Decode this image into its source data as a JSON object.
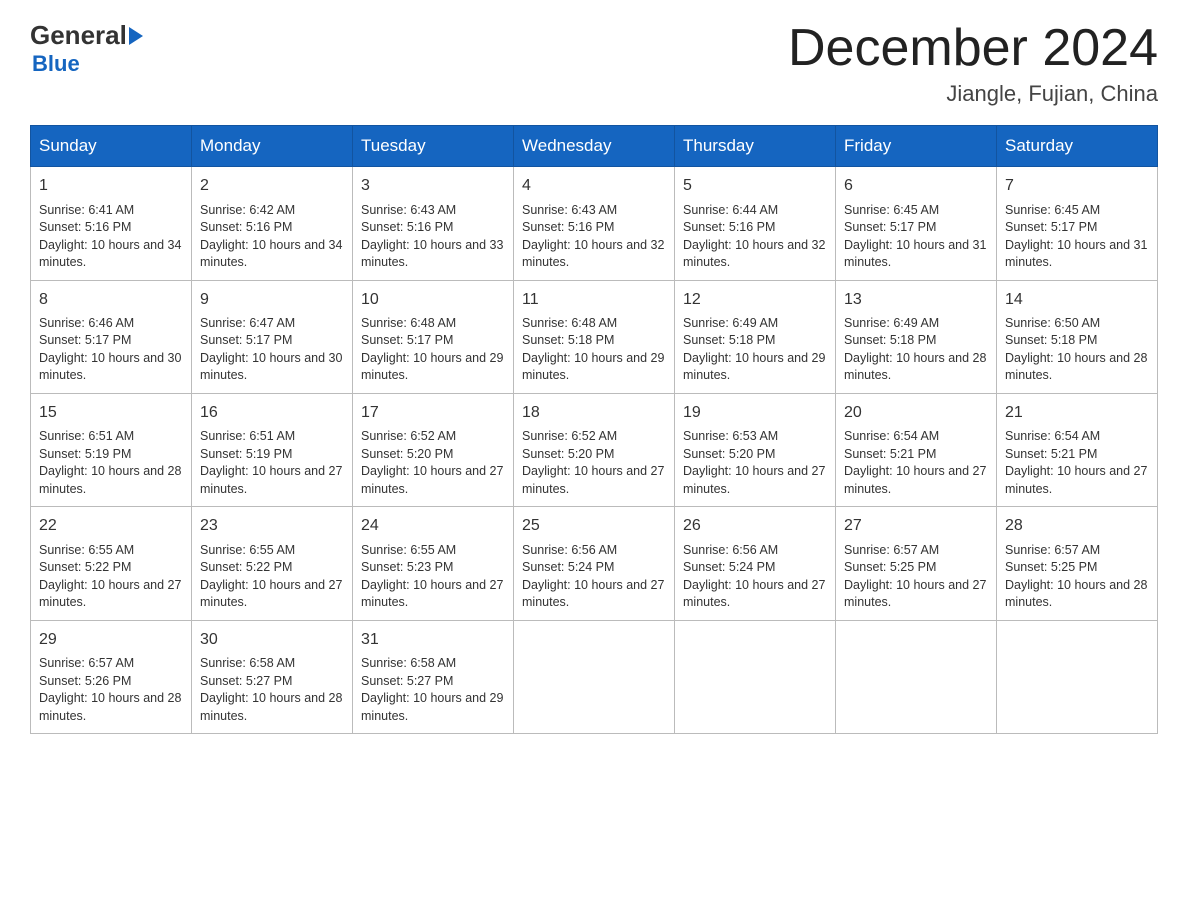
{
  "header": {
    "logo_general": "General",
    "logo_blue": "Blue",
    "month_title": "December 2024",
    "location": "Jiangle, Fujian, China"
  },
  "weekdays": [
    "Sunday",
    "Monday",
    "Tuesday",
    "Wednesday",
    "Thursday",
    "Friday",
    "Saturday"
  ],
  "weeks": [
    [
      {
        "day": "1",
        "sunrise": "6:41 AM",
        "sunset": "5:16 PM",
        "daylight": "10 hours and 34 minutes."
      },
      {
        "day": "2",
        "sunrise": "6:42 AM",
        "sunset": "5:16 PM",
        "daylight": "10 hours and 34 minutes."
      },
      {
        "day": "3",
        "sunrise": "6:43 AM",
        "sunset": "5:16 PM",
        "daylight": "10 hours and 33 minutes."
      },
      {
        "day": "4",
        "sunrise": "6:43 AM",
        "sunset": "5:16 PM",
        "daylight": "10 hours and 32 minutes."
      },
      {
        "day": "5",
        "sunrise": "6:44 AM",
        "sunset": "5:16 PM",
        "daylight": "10 hours and 32 minutes."
      },
      {
        "day": "6",
        "sunrise": "6:45 AM",
        "sunset": "5:17 PM",
        "daylight": "10 hours and 31 minutes."
      },
      {
        "day": "7",
        "sunrise": "6:45 AM",
        "sunset": "5:17 PM",
        "daylight": "10 hours and 31 minutes."
      }
    ],
    [
      {
        "day": "8",
        "sunrise": "6:46 AM",
        "sunset": "5:17 PM",
        "daylight": "10 hours and 30 minutes."
      },
      {
        "day": "9",
        "sunrise": "6:47 AM",
        "sunset": "5:17 PM",
        "daylight": "10 hours and 30 minutes."
      },
      {
        "day": "10",
        "sunrise": "6:48 AM",
        "sunset": "5:17 PM",
        "daylight": "10 hours and 29 minutes."
      },
      {
        "day": "11",
        "sunrise": "6:48 AM",
        "sunset": "5:18 PM",
        "daylight": "10 hours and 29 minutes."
      },
      {
        "day": "12",
        "sunrise": "6:49 AM",
        "sunset": "5:18 PM",
        "daylight": "10 hours and 29 minutes."
      },
      {
        "day": "13",
        "sunrise": "6:49 AM",
        "sunset": "5:18 PM",
        "daylight": "10 hours and 28 minutes."
      },
      {
        "day": "14",
        "sunrise": "6:50 AM",
        "sunset": "5:18 PM",
        "daylight": "10 hours and 28 minutes."
      }
    ],
    [
      {
        "day": "15",
        "sunrise": "6:51 AM",
        "sunset": "5:19 PM",
        "daylight": "10 hours and 28 minutes."
      },
      {
        "day": "16",
        "sunrise": "6:51 AM",
        "sunset": "5:19 PM",
        "daylight": "10 hours and 27 minutes."
      },
      {
        "day": "17",
        "sunrise": "6:52 AM",
        "sunset": "5:20 PM",
        "daylight": "10 hours and 27 minutes."
      },
      {
        "day": "18",
        "sunrise": "6:52 AM",
        "sunset": "5:20 PM",
        "daylight": "10 hours and 27 minutes."
      },
      {
        "day": "19",
        "sunrise": "6:53 AM",
        "sunset": "5:20 PM",
        "daylight": "10 hours and 27 minutes."
      },
      {
        "day": "20",
        "sunrise": "6:54 AM",
        "sunset": "5:21 PM",
        "daylight": "10 hours and 27 minutes."
      },
      {
        "day": "21",
        "sunrise": "6:54 AM",
        "sunset": "5:21 PM",
        "daylight": "10 hours and 27 minutes."
      }
    ],
    [
      {
        "day": "22",
        "sunrise": "6:55 AM",
        "sunset": "5:22 PM",
        "daylight": "10 hours and 27 minutes."
      },
      {
        "day": "23",
        "sunrise": "6:55 AM",
        "sunset": "5:22 PM",
        "daylight": "10 hours and 27 minutes."
      },
      {
        "day": "24",
        "sunrise": "6:55 AM",
        "sunset": "5:23 PM",
        "daylight": "10 hours and 27 minutes."
      },
      {
        "day": "25",
        "sunrise": "6:56 AM",
        "sunset": "5:24 PM",
        "daylight": "10 hours and 27 minutes."
      },
      {
        "day": "26",
        "sunrise": "6:56 AM",
        "sunset": "5:24 PM",
        "daylight": "10 hours and 27 minutes."
      },
      {
        "day": "27",
        "sunrise": "6:57 AM",
        "sunset": "5:25 PM",
        "daylight": "10 hours and 27 minutes."
      },
      {
        "day": "28",
        "sunrise": "6:57 AM",
        "sunset": "5:25 PM",
        "daylight": "10 hours and 28 minutes."
      }
    ],
    [
      {
        "day": "29",
        "sunrise": "6:57 AM",
        "sunset": "5:26 PM",
        "daylight": "10 hours and 28 minutes."
      },
      {
        "day": "30",
        "sunrise": "6:58 AM",
        "sunset": "5:27 PM",
        "daylight": "10 hours and 28 minutes."
      },
      {
        "day": "31",
        "sunrise": "6:58 AM",
        "sunset": "5:27 PM",
        "daylight": "10 hours and 29 minutes."
      },
      null,
      null,
      null,
      null
    ]
  ]
}
